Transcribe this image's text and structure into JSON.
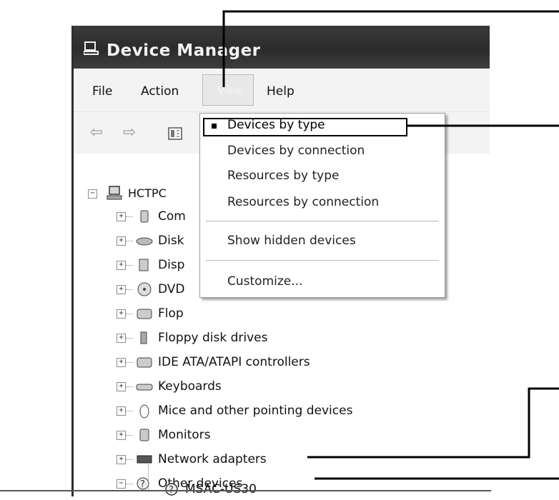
{
  "window": {
    "title": "Device Manager"
  },
  "menubar": {
    "items": [
      {
        "label": "File"
      },
      {
        "label": "Action"
      },
      {
        "label": "View"
      },
      {
        "label": "Help"
      }
    ]
  },
  "toolbar": {
    "buttons": [
      "back-arrow",
      "forward-arrow",
      "properties"
    ]
  },
  "tree": {
    "root": "HCTPC",
    "items": [
      {
        "label": "Com",
        "icon": "computer-icon"
      },
      {
        "label": "Disk",
        "icon": "disk-drive-icon"
      },
      {
        "label": "Disp",
        "icon": "display-adapter-icon"
      },
      {
        "label": "DVD",
        "icon": "dvd-drive-icon"
      },
      {
        "label": "Flop",
        "icon": "floppy-controller-icon"
      },
      {
        "label": "Floppy disk drives",
        "icon": "floppy-drive-icon"
      },
      {
        "label": "IDE ATA/ATAPI controllers",
        "icon": "ide-controller-icon"
      },
      {
        "label": "Keyboards",
        "icon": "keyboard-icon"
      },
      {
        "label": "Mice and other pointing devices",
        "icon": "mouse-icon"
      },
      {
        "label": "Monitors",
        "icon": "monitor-icon"
      },
      {
        "label": "Network adapters",
        "icon": "network-adapter-icon"
      },
      {
        "label": "Other devices",
        "icon": "unknown-device-icon"
      }
    ],
    "child": {
      "label": "MSAC-US30",
      "icon": "unknown-device-icon"
    }
  },
  "view_menu": {
    "selected": "Devices by type",
    "items": [
      "Devices by connection",
      "Resources by type",
      "Resources by connection"
    ],
    "show_hidden": "Show hidden devices",
    "customize": "Customize..."
  }
}
